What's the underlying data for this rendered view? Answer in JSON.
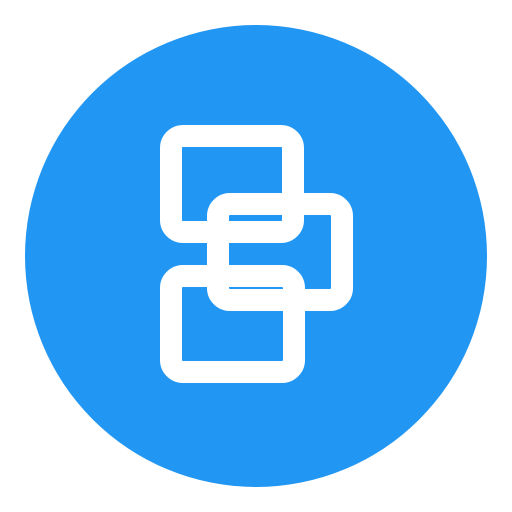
{
  "icon": {
    "name": "linked-windows-icon",
    "background_color": "#2196f3",
    "foreground_color": "#ffffff",
    "page_background": "#ffffff"
  }
}
